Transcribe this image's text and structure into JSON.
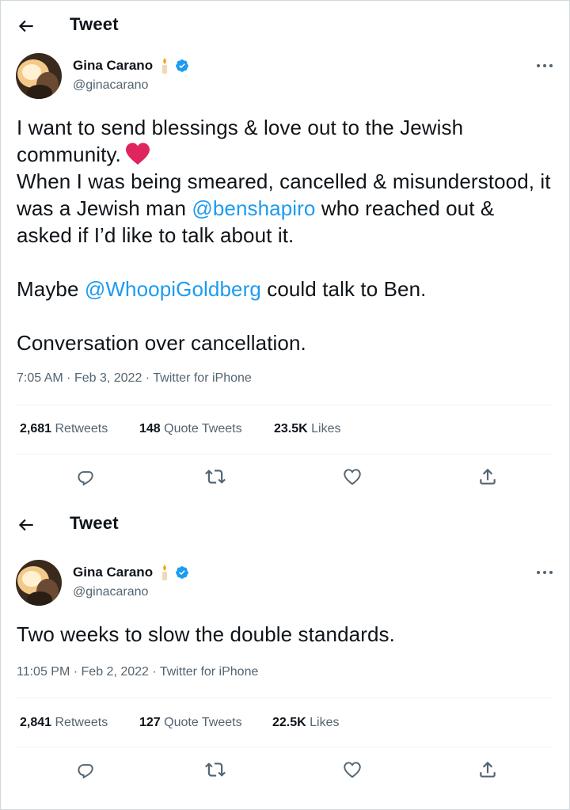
{
  "tweets": [
    {
      "header": {
        "title": "Tweet"
      },
      "author": {
        "name": "Gina Carano",
        "handle": "@ginacarano"
      },
      "body": {
        "p1_text": "I want to send blessings & love out to the Jewish community.",
        "p2_pre": "When I was being smeared, cancelled & misunderstood, it was a Jewish man ",
        "p2_mention": "@benshapiro",
        "p2_post": " who reached out & asked if I’d like to talk about it.",
        "p3_pre": "Maybe ",
        "p3_mention": "@WhoopiGoldberg",
        "p3_post": " could talk to Ben.",
        "p4_text": "Conversation over cancellation."
      },
      "meta": {
        "time": "7:05 AM",
        "date": "Feb 3, 2022",
        "source": "Twitter for iPhone"
      },
      "stats": {
        "retweets": "2,681",
        "retweets_label": "Retweets",
        "quotes": "148",
        "quotes_label": "Quote Tweets",
        "likes": "23.5K",
        "likes_label": "Likes"
      }
    },
    {
      "header": {
        "title": "Tweet"
      },
      "author": {
        "name": "Gina Carano",
        "handle": "@ginacarano"
      },
      "body": {
        "p1_text": "Two weeks to slow the double standards."
      },
      "meta": {
        "time": "11:05 PM",
        "date": "Feb 2, 2022",
        "source": "Twitter for iPhone"
      },
      "stats": {
        "retweets": "2,841",
        "retweets_label": "Retweets",
        "quotes": "127",
        "quotes_label": "Quote Tweets",
        "likes": "22.5K",
        "likes_label": "Likes"
      }
    }
  ],
  "ui": {
    "meta_separator": "·"
  },
  "icons": {
    "back": "arrow-left-icon",
    "verified": "verified-badge-icon",
    "emoji": "candle-emoji-icon",
    "more": "more-horizontal-icon",
    "reply": "reply-icon",
    "retweet": "retweet-icon",
    "like": "heart-outline-icon",
    "share": "share-icon",
    "heart_emoji": "red-heart-emoji-icon"
  },
  "colors": {
    "accent": "#1d9bf0",
    "text": "#0f1419",
    "secondary": "#536471",
    "heart": "#e0245e"
  }
}
